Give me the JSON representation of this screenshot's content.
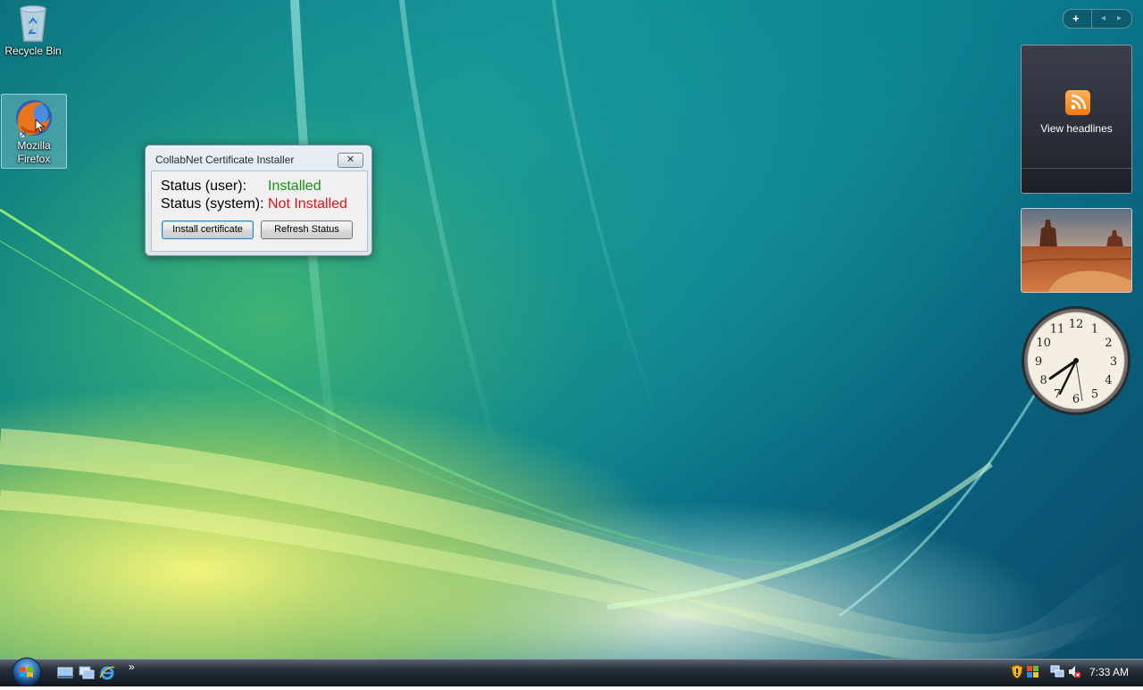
{
  "desktop": {
    "icons": [
      {
        "label": "Recycle Bin",
        "icon": "recycle-bin-icon"
      },
      {
        "label_line1": "Mozilla",
        "label_line2": "Firefox",
        "icon": "firefox-icon"
      }
    ]
  },
  "dialog": {
    "title": "CollabNet Certificate Installer",
    "close_glyph": "✕",
    "status_user_label": "Status (user):",
    "status_user_value": "Installed",
    "status_system_label": "Status (system):",
    "status_system_value": "Not Installed",
    "install_button": "Install certificate",
    "refresh_button": "Refresh Status",
    "colors": {
      "installed": "#1a8f1a",
      "not_installed": "#e0101a"
    }
  },
  "sidebar": {
    "add_glyph": "+",
    "prev_glyph": "◂",
    "next_glyph": "▸",
    "feed_gadget_label": "View headlines",
    "clock_numbers": [
      "12",
      "1",
      "2",
      "3",
      "4",
      "5",
      "6",
      "7",
      "8",
      "9",
      "10",
      "11"
    ]
  },
  "taskbar": {
    "quick_launch": [
      "show-desktop-icon",
      "switch-windows-icon",
      "internet-explorer-icon"
    ],
    "overflow_glyph": "»",
    "tray_icons": [
      "security-shield-icon",
      "windows-update-icon",
      "network-icon",
      "volume-muted-icon"
    ],
    "clock": "7:33 AM"
  }
}
